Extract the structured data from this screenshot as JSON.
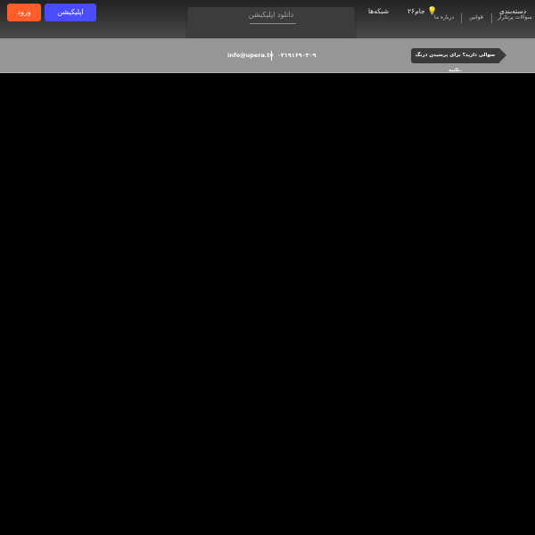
{
  "header": {
    "login_label": "ورود",
    "app_label": "اپلیکیشن",
    "download_label": "دانلود اپلیکیشن",
    "nav": {
      "networks": "شبکه‌ها",
      "cup": "جام۲۶",
      "categories": "دسته‌بندی"
    },
    "subnav": {
      "about": "درباره ما",
      "rules": "قوانین",
      "faq": "سوالات پرتکرار"
    }
  },
  "contact": {
    "email": "info@upera.tv",
    "phone": "۰۲۱۹۱۶۹۰۳۰۹",
    "tooltip": "سوالی دارید؟ برای پرسیدن درنگ نکنید."
  },
  "colors": {
    "login": "#ff5e2a",
    "app": "#4a4cff",
    "cup_icon": "#ffcc22"
  }
}
